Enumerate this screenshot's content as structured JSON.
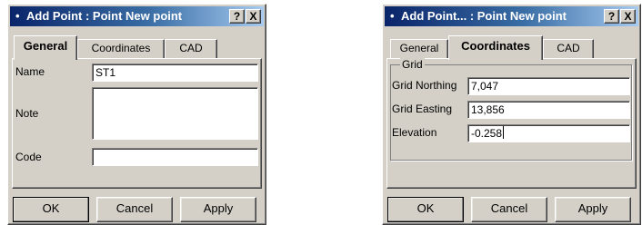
{
  "dialogs": [
    {
      "title": "Add Point : Point New point",
      "help_label": "?",
      "close_label": "X",
      "tabs": [
        "General",
        "Coordinates",
        "CAD"
      ],
      "active_tab": "General",
      "fields": {
        "name_label": "Name",
        "name_value": "ST1",
        "note_label": "Note",
        "note_value": "",
        "code_label": "Code",
        "code_value": ""
      },
      "buttons": {
        "ok": "OK",
        "cancel": "Cancel",
        "apply": "Apply"
      }
    },
    {
      "title": "Add Point... : Point New point",
      "help_label": "?",
      "close_label": "X",
      "tabs": [
        "General",
        "Coordinates",
        "CAD"
      ],
      "active_tab": "Coordinates",
      "group_label": "Grid",
      "fields": {
        "northing_label": "Grid Northing",
        "northing_value": "7,047",
        "easting_label": "Grid Easting",
        "easting_value": "13,856",
        "elevation_label": "Elevation",
        "elevation_value": "-0.258"
      },
      "buttons": {
        "ok": "OK",
        "cancel": "Cancel",
        "apply": "Apply"
      }
    }
  ],
  "colors": {
    "title_start": "#0a246a",
    "title_end": "#a6caf0",
    "face": "#d4d0c8"
  }
}
